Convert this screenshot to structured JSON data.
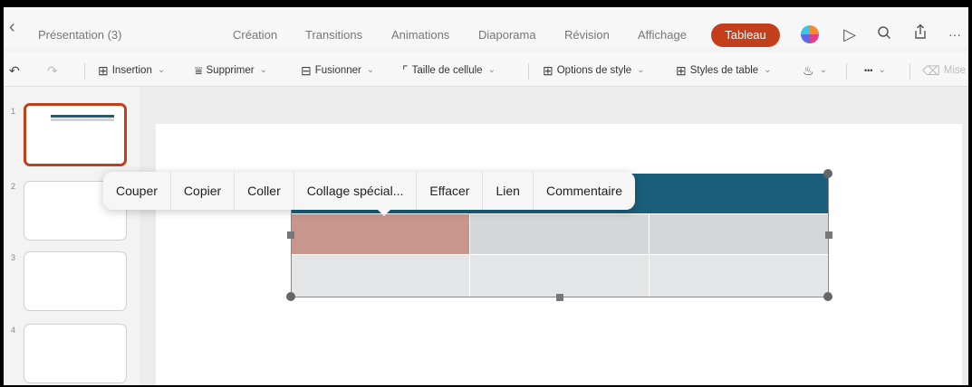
{
  "app": {
    "doc_title": "Présentation (3)",
    "tabs": [
      "Création",
      "Transitions",
      "Animations",
      "Diaporama",
      "Révision",
      "Affichage"
    ],
    "active_tab": "Tableau",
    "accent_color": "#c43e1c"
  },
  "ribbon": {
    "insertion": "Insertion",
    "supprimer": "Supprimer",
    "fusionner": "Fusionner",
    "taille": "Taille de cellule",
    "options": "Options de style",
    "styles": "Styles de table",
    "more": "•••",
    "faded": "Mise"
  },
  "thumbnails": [
    "1",
    "2",
    "3",
    "4"
  ],
  "context_menu": [
    "Couper",
    "Copier",
    "Coller",
    "Collage spécial...",
    "Effacer",
    "Lien",
    "Commentaire"
  ],
  "table": {
    "header_color": "#1b5e7b",
    "selected_cell_color": "#c9968d"
  }
}
